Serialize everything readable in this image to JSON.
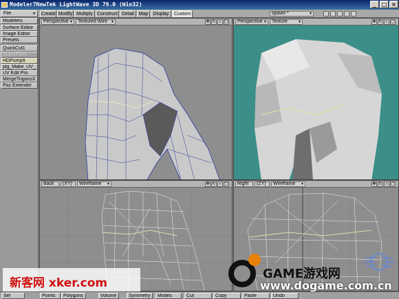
{
  "window": {
    "title": "Modeler7NewTek LightWave 3D 79.0 (Win32)",
    "buttons": [
      "_",
      "□",
      "×"
    ]
  },
  "tabs": [
    {
      "label": "Create"
    },
    {
      "label": "Modify"
    },
    {
      "label": "Multiply"
    },
    {
      "label": "Construct"
    },
    {
      "label": "Detail"
    },
    {
      "label": "Map"
    },
    {
      "label": "Display"
    },
    {
      "label": "Custom",
      "active": true
    }
  ],
  "layer_select": "spawn *",
  "sidebar": {
    "items": [
      {
        "label": "File"
      },
      {
        "label": "Modelers"
      },
      {
        "label": "Surface Editor"
      },
      {
        "label": "Image Editor"
      },
      {
        "label": "Presets"
      },
      {
        "label": "QuickCut1"
      },
      {
        "label": "SuperPaint"
      },
      {
        "label": "HDPumpIt"
      },
      {
        "label": "plg_Make_UV_"
      },
      {
        "label": "UV Edit Pro"
      },
      {
        "label": "MergeTrigonsX"
      },
      {
        "label": "Poz Extender"
      }
    ]
  },
  "viewports": {
    "tl": {
      "view": "Perspective",
      "mode": "Textured Wire"
    },
    "tr": {
      "view": "Perspective",
      "mode": "Texture"
    },
    "bl": {
      "view": "Back",
      "axes": "(XY)",
      "mode": "Wireframe"
    },
    "br": {
      "view": "Right",
      "axes": "(ZY)",
      "mode": "Wireframe"
    }
  },
  "bottom_bar": {
    "items": [
      "Sel",
      "Points",
      "Polygons",
      "Volume",
      "Symmetry",
      "Modes",
      "Cut",
      "Copy",
      "Paste",
      "Undo"
    ]
  },
  "watermarks": {
    "left": "新客网 xker.com",
    "right_brand": "GAME游戏网",
    "right_url": "www.dogame.com.cn"
  },
  "colors": {
    "viewport_gray": "#8e8e8e",
    "texture_bg": "#3b8f88",
    "wire_blue": "#2a3aa0",
    "wire_white": "#ffffff",
    "title_blue": "#0a246a"
  }
}
